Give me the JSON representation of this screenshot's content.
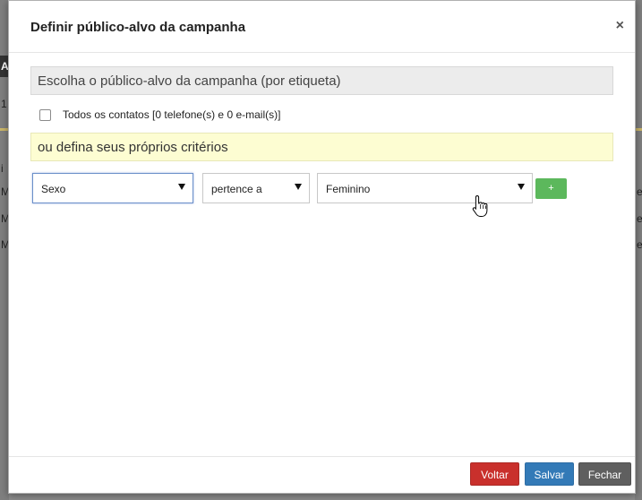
{
  "background": {
    "fragments": [
      "A",
      "i",
      "M",
      "M",
      "M",
      "e",
      "e",
      "e",
      "1"
    ]
  },
  "modal": {
    "title": "Definir público-alvo da campanha",
    "close_glyph": "×",
    "label_section": "Escolha o público-alvo da campanha (por etiqueta)",
    "all_contacts_label": "Todos os contatos [0 telefone(s) e 0 e-mail(s)]",
    "custom_section": "ou defina seus próprios critérios",
    "criteria": {
      "field_value": "Sexo",
      "operator_value": "pertence a",
      "value_value": "Feminino",
      "add_label": "+"
    },
    "footer": {
      "back_label": "Voltar",
      "save_label": "Salvar",
      "close_label": "Fechar"
    }
  },
  "colors": {
    "add_button": "#5cb85c",
    "back_button": "#c9302c",
    "save_button": "#337ab7",
    "close_button": "#5f5f5f",
    "custom_section_bg": "#fdfdd2"
  },
  "icons": {
    "cursor": "hand-pointer-icon",
    "close": "close-icon",
    "dropdown": "caret-down-icon"
  }
}
